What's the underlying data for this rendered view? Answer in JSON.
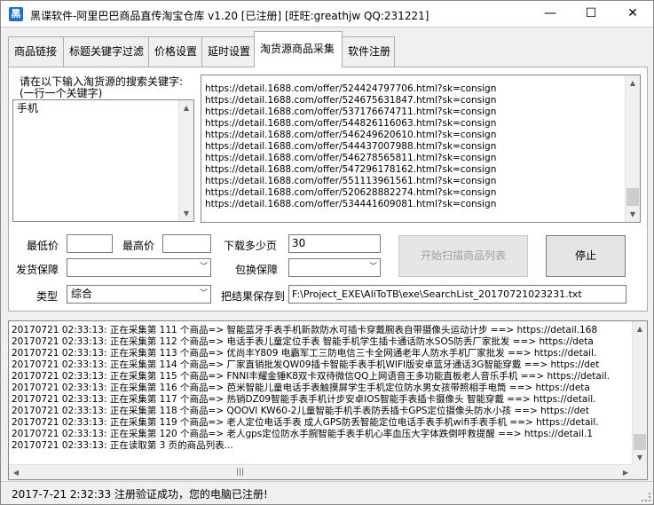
{
  "window": {
    "title": "黑谍软件-阿里巴巴商品直传淘宝仓库  v1.20 [已注册] [旺旺:greathjw QQ:231221]",
    "minimize": "—",
    "maximize": "☐",
    "close": "✕"
  },
  "tabs": [
    {
      "label": "商品链接"
    },
    {
      "label": "标题关键字过滤"
    },
    {
      "label": "价格设置"
    },
    {
      "label": "延时设置"
    },
    {
      "label": "淘货源商品采集"
    },
    {
      "label": "软件注册"
    }
  ],
  "collect": {
    "keyword_prompt_1": "请在以下输入淘货源的搜索关键字:",
    "keyword_prompt_2": "(一行一个关键字)",
    "keywords": "手机",
    "urls": [
      "https://detail.1688.com/offer/524424797706.html?sk=consign",
      "https://detail.1688.com/offer/524675631847.html?sk=consign",
      "https://detail.1688.com/offer/537176674711.html?sk=consign",
      "https://detail.1688.com/offer/544826116063.html?sk=consign",
      "https://detail.1688.com/offer/546249620610.html?sk=consign",
      "https://detail.1688.com/offer/544437007988.html?sk=consign",
      "https://detail.1688.com/offer/546278565811.html?sk=consign",
      "https://detail.1688.com/offer/547296178162.html?sk=consign",
      "https://detail.1688.com/offer/551113961561.html?sk=consign",
      "https://detail.1688.com/offer/520628882274.html?sk=consign",
      "https://detail.1688.com/offer/534441609081.html?sk=consign"
    ],
    "min_price_label": "最低价",
    "min_price": "",
    "max_price_label": "最高价",
    "max_price": "",
    "pages_label": "下载多少页",
    "pages": "30",
    "ship_label": "发货保障",
    "ship_value": "",
    "exchange_label": "包换保障",
    "exchange_value": "",
    "type_label": "类型",
    "type_value": "综合",
    "save_label": "把结果保存到",
    "save_path": "F:\\Project_EXE\\AliToTB\\exe\\SearchList_20170721023231.txt",
    "start_button": "开始扫描商品列表",
    "stop_button": "停止"
  },
  "log": [
    "20170721 02:33:13:  正在采集第 111 个商品=> 智能蓝牙手表手机新款防水可插卡穿戴腕表自带摄像头运动计步 ==> https://detail.168",
    "20170721 02:33:13:  正在采集第 112 个商品=> 电话手表儿童定位手表 智能手机学生插卡通话防水SOS防丢厂家批发 ==> https://deta",
    "20170721 02:33:13:  正在采集第 113 个商品=> 优尚丰Y809 电霸军工三防电信三卡全网通老年人防水手机厂家批发 ==> https://detail.",
    "20170721 02:33:13:  正在采集第 114 个商品=> 厂家直销批发QW09插卡智能手表手机WIFI版安卓蓝牙通话3G智能穿戴 ==> https://det",
    "20170721 02:33:13:  正在采集第 115 个商品=> FNNI丰耀金锤K8双卡双待微信QQ上网语音王多功能直板老人音乐手机 ==> https://detail.",
    "20170721 02:33:13:  正在采集第 116 个商品=> 芭米智能儿童电话手表触摸屏学生手机定位防水男女孩带照相手电筒 ==> https://deta",
    "20170721 02:33:13:  正在采集第 117 个商品=> 热销DZ09智能手表手机计步安卓IOS智能手表插卡摄像头 智能穿戴 ==> https://detail.",
    "20170721 02:33:13:  正在采集第 118 个商品=> QOOVI KW60-2儿童智能手机手表防丢插卡GPS定位摄像头防水小孩 ==> https://det",
    "20170721 02:33:13:  正在采集第 119 个商品=> 老人定位电话手表 成人GPS防丢智能定位电话手表手机wifi手表手机 ==> https://detail.",
    "20170721 02:33:13:  正在采集第 120 个商品=> 老人gps定位防水手腕智能手表手机心率血压大字体跌倒呼救提醒 ==> https://detail.1",
    "20170721 02:33:13:  正在读取第 3 页的商品列表..."
  ],
  "status": {
    "text": "2017-7-21 2:32:33  注册验证成功，您的电脑已注册!"
  }
}
